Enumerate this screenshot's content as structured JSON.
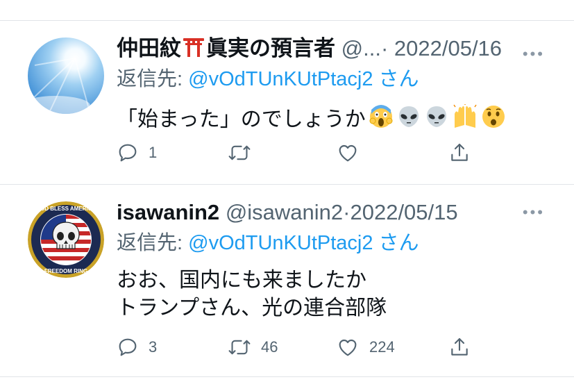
{
  "tweets": [
    {
      "name": "仲田紋",
      "name_suffix": "眞実の預言者",
      "handle": "@...",
      "separator": "·",
      "date": "2022/05/16",
      "more": "•••",
      "reply_prefix": "返信先: ",
      "reply_to": "@vOdTUnKUtPtacj2",
      "reply_suffix": " さん",
      "lines": [
        "「始まった」のでしょうか"
      ],
      "emojis": [
        "screaming-face",
        "alien",
        "alien",
        "raising-hands",
        "astonished-face"
      ],
      "counts": {
        "reply": "1",
        "retweet": "",
        "like": ""
      }
    },
    {
      "name": "isawanin2",
      "handle": "@isawanin2",
      "separator": "·",
      "date": "2022/05/15",
      "more": "•••",
      "reply_prefix": "返信先: ",
      "reply_to": "@vOdTUnKUtPtacj2",
      "reply_suffix": " さん",
      "lines": [
        "おお、国内にも来ましたか",
        "トランプさん、光の連合部隊"
      ],
      "counts": {
        "reply": "3",
        "retweet": "46",
        "like": "224"
      },
      "avatar_text": "GOD BLESS AMERICA · FREEDOM RING"
    }
  ],
  "colors": {
    "link": "#1d9bf0",
    "muted": "#536471",
    "text": "#0f1419",
    "divider": "#e1e4e8"
  }
}
